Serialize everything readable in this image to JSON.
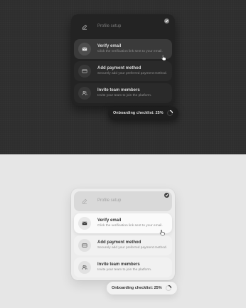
{
  "progress": {
    "label": "Onboarding checklist:",
    "percent_text": "25%",
    "fraction": 0.25
  },
  "steps": [
    {
      "title": "Profile setup",
      "description": "",
      "icon": "edit-icon",
      "state": "completed"
    },
    {
      "title": "Verify email",
      "description": "Click the verification link sent to your email.",
      "icon": "mail-icon",
      "state": "active"
    },
    {
      "title": "Add payment method",
      "description": "Securely add your preferred payment method.",
      "icon": "credit-card-icon",
      "state": "pending"
    },
    {
      "title": "Invite team members",
      "description": "Invite your team to join the platform.",
      "icon": "users-icon",
      "state": "pending"
    }
  ],
  "themes": [
    "dark",
    "light"
  ],
  "colors": {
    "dark_bg": "#2e2e2e",
    "light_bg": "#e6e6e6",
    "dark_card": "#232323",
    "light_card": "#ececec"
  }
}
